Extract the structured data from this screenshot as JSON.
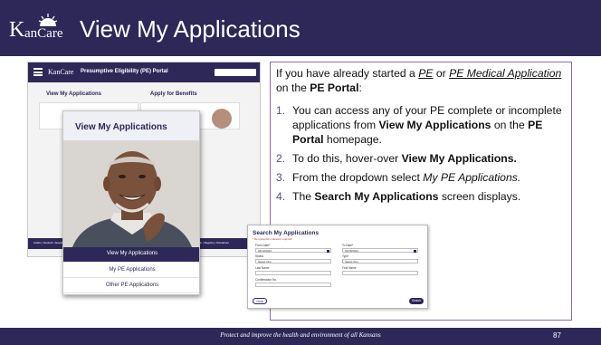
{
  "slide": {
    "logo_k": "K",
    "logo_rest": "anCare",
    "title": "View My Applications",
    "footer": "Protect and improve the health and environment of all Kansans",
    "page_number": "87"
  },
  "portal": {
    "logo": "KanCare",
    "title": "Presumptive Eligibility (PE) Portal",
    "tabs": [
      "View My Applications",
      "Apply for Benefits"
    ],
    "footer_left": "Arabic | Deutsch | Español",
    "footer_right": "Help | Registry | Disclaimer"
  },
  "popup": {
    "title": "View My Applications",
    "menu": [
      "View My Applications",
      "My PE Applications",
      "Other PE Applications"
    ]
  },
  "instructions": {
    "intro_1": "If you have already started a ",
    "pe": "PE",
    "intro_or": " or ",
    "pe_medical_application": "PE Medical Application",
    "intro_2": " on the ",
    "pe_portal": "PE Portal",
    "intro_colon": ":",
    "item1_num": "1.",
    "item1_a": "You can access any of your PE complete or incomplete applications from ",
    "item1_b": "View My Applications",
    "item1_c": " on the ",
    "item1_d": "PE Portal",
    "item1_e": " homepage.",
    "item2_num": "2.",
    "item2_a": "To do this, hover-over ",
    "item2_b": "View My Applications.",
    "item3_num": "3.",
    "item3_a": "From the dropdown select ",
    "item3_b": "My PE Applications.",
    "item4_num": "4.",
    "item4_a": "The ",
    "item4_b": "Search My Applications",
    "item4_c": " screen displays."
  },
  "search_form": {
    "title": "Search My Applications",
    "required_note": "* Red asterisk indicates required",
    "from_date_label": "From Date*",
    "from_date_value": "04/12/2021",
    "to_date_label": "To Date*",
    "to_date_value": "04/26/2021",
    "status_label": "Status",
    "status_value": "Select One",
    "type_label": "Type",
    "type_value": "Select One",
    "last_name_label": "Last Name",
    "first_name_label": "First Name",
    "confirmation_label": "Confirmation No.",
    "clear_button": "Clear",
    "search_button": "Search"
  },
  "colors": {
    "brand_navy": "#2d2858",
    "box_border": "#8b6cb3"
  }
}
